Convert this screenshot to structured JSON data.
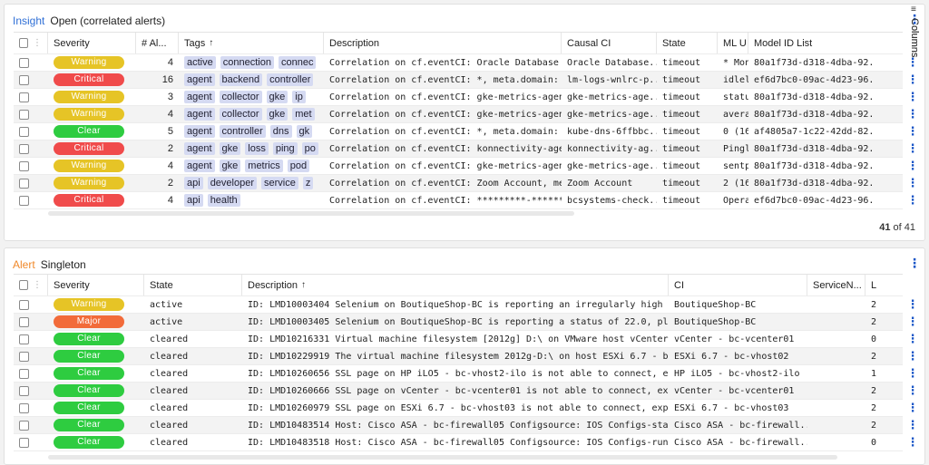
{
  "colors": {
    "warning": "#e6c426",
    "critical": "#f04b4b",
    "clear": "#2ecc40",
    "major": "#f26b3a",
    "accent_insight": "#2f6fd6",
    "accent_alert": "#f0892a"
  },
  "insight": {
    "kind": "Insight",
    "title": "Open (correlated alerts)",
    "menu_icon": "kebab-icon",
    "headers": {
      "severity": "Severity",
      "alerts": "# Al...",
      "tags": "Tags",
      "tags_sort": "↑",
      "description": "Description",
      "causal_ci": "Causal CI",
      "state": "State",
      "ml": "ML U",
      "model": "Model ID List"
    },
    "rows": [
      {
        "severity": "Warning",
        "sev": "warning",
        "alerts": "4",
        "tags": [
          "active",
          "connection",
          "connec"
        ],
        "description": "Correlation on cf.eventCI: Oracle Database ...",
        "causal_ci": "Oracle Database...",
        "state": "timeout",
        "ml": "* Mon",
        "model": "80a1f73d-d318-4dba-92..."
      },
      {
        "severity": "Critical",
        "sev": "critical",
        "alerts": "16",
        "tags": [
          "agent",
          "backend",
          "controller"
        ],
        "description": "Correlation on cf.eventCI: *, meta.domain: ...",
        "causal_ci": "lm-logs-wnlrc-p...",
        "state": "timeout",
        "ml": "idlel",
        "model": "ef6d7bc0-09ac-4d23-96..."
      },
      {
        "severity": "Warning",
        "sev": "warning",
        "alerts": "3",
        "tags": [
          "agent",
          "collector",
          "gke",
          "ip"
        ],
        "description": "Correlation on cf.eventCI: gke-metrics-agen...",
        "causal_ci": "gke-metrics-age...",
        "state": "timeout",
        "ml": "statu",
        "model": "80a1f73d-d318-4dba-92..."
      },
      {
        "severity": "Warning",
        "sev": "warning",
        "alerts": "4",
        "tags": [
          "agent",
          "collector",
          "gke",
          "met"
        ],
        "description": "Correlation on cf.eventCI: gke-metrics-agen...",
        "causal_ci": "gke-metrics-age...",
        "state": "timeout",
        "ml": "avera",
        "model": "80a1f73d-d318-4dba-92..."
      },
      {
        "severity": "Clear",
        "sev": "clear",
        "alerts": "5",
        "tags": [
          "agent",
          "controller",
          "dns",
          "gk"
        ],
        "description": "Correlation on cf.eventCI: *, meta.domain: ...",
        "causal_ci": "kube-dns-6ffbbc...",
        "state": "timeout",
        "ml": "0 (16",
        "model": "af4805a7-1c22-42dd-82..."
      },
      {
        "severity": "Critical",
        "sev": "critical",
        "alerts": "2",
        "tags": [
          "agent",
          "gke",
          "loss",
          "ping",
          "po"
        ],
        "description": "Correlation on cf.eventCI: konnectivity-age...",
        "causal_ci": "konnectivity-ag...",
        "state": "timeout",
        "ml": "Pingl",
        "model": "80a1f73d-d318-4dba-92..."
      },
      {
        "severity": "Warning",
        "sev": "warning",
        "alerts": "4",
        "tags": [
          "agent",
          "gke",
          "metrics",
          "pod"
        ],
        "description": "Correlation on cf.eventCI: gke-metrics-agen...",
        "causal_ci": "gke-metrics-age...",
        "state": "timeout",
        "ml": "sentp",
        "model": "80a1f73d-d318-4dba-92..."
      },
      {
        "severity": "Warning",
        "sev": "warning",
        "alerts": "2",
        "tags": [
          "api",
          "developer",
          "service",
          "z"
        ],
        "description": "Correlation on cf.eventCI: Zoom Account, me...",
        "causal_ci": "Zoom Account",
        "state": "timeout",
        "ml": "2 (16",
        "model": "80a1f73d-d318-4dba-92..."
      },
      {
        "severity": "Critical",
        "sev": "critical",
        "alerts": "4",
        "tags": [
          "api",
          "health"
        ],
        "description": "Correlation on cf.eventCI: *********-******...",
        "causal_ci": "bcsystems-check...",
        "state": "timeout",
        "ml": "Opera",
        "model": "ef6d7bc0-09ac-4d23-96..."
      }
    ],
    "footer_count": "41",
    "footer_of": "of 41",
    "columns_label": "Columns"
  },
  "alert": {
    "kind": "Alert",
    "title": "Singleton",
    "menu_icon": "kebab-icon",
    "headers": {
      "severity": "Severity",
      "state": "State",
      "description": "Description",
      "description_sort": "↑",
      "ci": "CI",
      "service": "ServiceN...",
      "l": "L"
    },
    "rows": [
      {
        "severity": "Warning",
        "sev": "warning",
        "state": "active",
        "description": "ID: LMD10003404 Selenium on BoutiqueShop-BC is reporting an irregularly high la...",
        "ci": "BoutiqueShop-BC",
        "l": "2"
      },
      {
        "severity": "Major",
        "sev": "major",
        "state": "active",
        "description": "ID: LMD10003405 Selenium on BoutiqueShop-BC is reporting a status of 22.0, plac...",
        "ci": "BoutiqueShop-BC",
        "l": "2"
      },
      {
        "severity": "Clear",
        "sev": "clear",
        "state": "cleared",
        "description": "ID: LMD10216331 Virtual machine filesystem [2012g] D:\\ on VMware host vCenter -...",
        "ci": "vCenter - bc-vcenter01",
        "l": "0"
      },
      {
        "severity": "Clear",
        "sev": "clear",
        "state": "cleared",
        "description": "ID: LMD10229919 The virtual machine filesystem 2012g-D:\\ on host ESXi 6.7 - bc-...",
        "ci": "ESXi 6.7 - bc-vhost02",
        "l": "2"
      },
      {
        "severity": "Clear",
        "sev": "clear",
        "state": "cleared",
        "description": "ID: LMD10260656 SSL page on HP iLO5 - bc-vhost2-ilo is not able to connect, exp...",
        "ci": "HP iLO5 - bc-vhost2-ilo",
        "l": "1"
      },
      {
        "severity": "Clear",
        "sev": "clear",
        "state": "cleared",
        "description": "ID: LMD10260666 SSL page on vCenter - bc-vcenter01 is not able to connect, expe...",
        "ci": "vCenter - bc-vcenter01",
        "l": "2"
      },
      {
        "severity": "Clear",
        "sev": "clear",
        "state": "cleared",
        "description": "ID: LMD10260979 SSL page on ESXi 6.7 - bc-vhost03 is not able to connect, exper...",
        "ci": "ESXi 6.7 - bc-vhost03",
        "l": "2"
      },
      {
        "severity": "Clear",
        "sev": "clear",
        "state": "cleared",
        "description": "ID: LMD10483514 Host: Cisco ASA - bc-firewall05 Configsource: IOS Configs-start...",
        "ci": "Cisco ASA - bc-firewall...",
        "l": "2"
      },
      {
        "severity": "Clear",
        "sev": "clear",
        "state": "cleared",
        "description": "ID: LMD10483518 Host: Cisco ASA - bc-firewall05 Configsource: IOS Configs-runni...",
        "ci": "Cisco ASA - bc-firewall...",
        "l": "0"
      }
    ],
    "columns_label": "Columns"
  }
}
